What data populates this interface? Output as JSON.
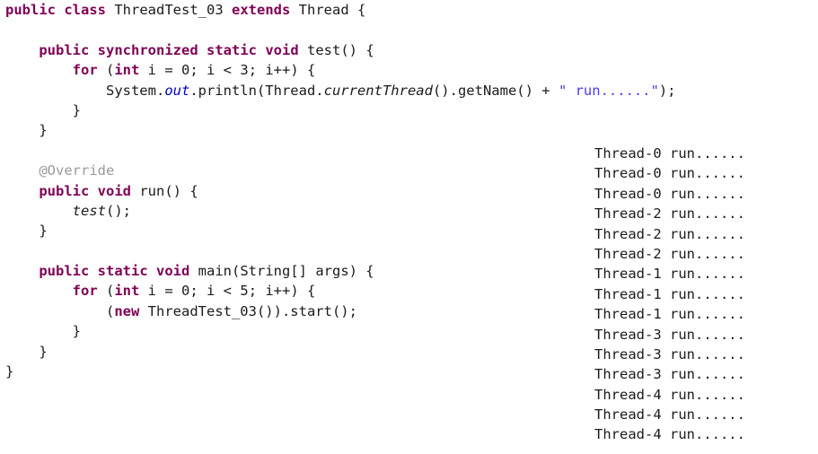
{
  "editor": {
    "name": "java-source-editor",
    "language": "Java",
    "class_name": "ThreadTest_03",
    "colors": {
      "background": "#ffffff",
      "keyword": "#7f0055",
      "identifier": "#1b1b1b",
      "string": "#4a3cf0",
      "static_field": "#0000c8",
      "annotation": "#9a9a9a",
      "console_text": "#1b1b1b"
    },
    "lines": [
      {
        "indent": 0,
        "tokens": [
          {
            "t": "public",
            "c": "kw"
          },
          {
            "t": " ",
            "c": "plain"
          },
          {
            "t": "class",
            "c": "kw"
          },
          {
            "t": " ThreadTest_03 ",
            "c": "ident"
          },
          {
            "t": "extends",
            "c": "kw"
          },
          {
            "t": " Thread {",
            "c": "ident"
          }
        ]
      },
      {
        "indent": 0,
        "tokens": []
      },
      {
        "indent": 1,
        "tokens": [
          {
            "t": "public",
            "c": "kw"
          },
          {
            "t": " ",
            "c": "plain"
          },
          {
            "t": "synchronized",
            "c": "kw"
          },
          {
            "t": " ",
            "c": "plain"
          },
          {
            "t": "static",
            "c": "kw"
          },
          {
            "t": " ",
            "c": "plain"
          },
          {
            "t": "void",
            "c": "kw"
          },
          {
            "t": " test() {",
            "c": "ident"
          }
        ]
      },
      {
        "indent": 2,
        "tokens": [
          {
            "t": "for",
            "c": "kw"
          },
          {
            "t": " (",
            "c": "ident"
          },
          {
            "t": "int",
            "c": "kw"
          },
          {
            "t": " i = ",
            "c": "ident"
          },
          {
            "t": "0",
            "c": "num"
          },
          {
            "t": "; i < ",
            "c": "ident"
          },
          {
            "t": "3",
            "c": "num"
          },
          {
            "t": "; i++) {",
            "c": "ident"
          }
        ]
      },
      {
        "indent": 3,
        "tokens": [
          {
            "t": "System.",
            "c": "ident"
          },
          {
            "t": "out",
            "c": "fieldit"
          },
          {
            "t": ".println(Thread.",
            "c": "ident"
          },
          {
            "t": "currentThread",
            "c": "staticm"
          },
          {
            "t": "().getName() + ",
            "c": "ident"
          },
          {
            "t": "\" run......\"",
            "c": "str"
          },
          {
            "t": ");",
            "c": "ident"
          }
        ]
      },
      {
        "indent": 2,
        "tokens": [
          {
            "t": "}",
            "c": "ident"
          }
        ]
      },
      {
        "indent": 1,
        "tokens": [
          {
            "t": "}",
            "c": "ident"
          }
        ]
      },
      {
        "indent": 0,
        "tokens": []
      },
      {
        "indent": 1,
        "tokens": [
          {
            "t": "@Override",
            "c": "anno"
          }
        ]
      },
      {
        "indent": 1,
        "tokens": [
          {
            "t": "public",
            "c": "kw"
          },
          {
            "t": " ",
            "c": "plain"
          },
          {
            "t": "void",
            "c": "kw"
          },
          {
            "t": " run() {",
            "c": "ident"
          }
        ]
      },
      {
        "indent": 2,
        "tokens": [
          {
            "t": "test",
            "c": "staticm"
          },
          {
            "t": "();",
            "c": "ident"
          }
        ]
      },
      {
        "indent": 1,
        "tokens": [
          {
            "t": "}",
            "c": "ident"
          }
        ]
      },
      {
        "indent": 0,
        "tokens": []
      },
      {
        "indent": 1,
        "tokens": [
          {
            "t": "public",
            "c": "kw"
          },
          {
            "t": " ",
            "c": "plain"
          },
          {
            "t": "static",
            "c": "kw"
          },
          {
            "t": " ",
            "c": "plain"
          },
          {
            "t": "void",
            "c": "kw"
          },
          {
            "t": " main(String[] args) {",
            "c": "ident"
          }
        ]
      },
      {
        "indent": 2,
        "tokens": [
          {
            "t": "for",
            "c": "kw"
          },
          {
            "t": " (",
            "c": "ident"
          },
          {
            "t": "int",
            "c": "kw"
          },
          {
            "t": " i = ",
            "c": "ident"
          },
          {
            "t": "0",
            "c": "num"
          },
          {
            "t": "; i < ",
            "c": "ident"
          },
          {
            "t": "5",
            "c": "num"
          },
          {
            "t": "; i++) {",
            "c": "ident"
          }
        ]
      },
      {
        "indent": 3,
        "tokens": [
          {
            "t": "(",
            "c": "ident"
          },
          {
            "t": "new",
            "c": "kw"
          },
          {
            "t": " ThreadTest_03()).start();",
            "c": "ident"
          }
        ]
      },
      {
        "indent": 2,
        "tokens": [
          {
            "t": "}",
            "c": "ident"
          }
        ]
      },
      {
        "indent": 1,
        "tokens": [
          {
            "t": "}",
            "c": "ident"
          }
        ]
      },
      {
        "indent": 0,
        "tokens": [
          {
            "t": "}",
            "c": "ident"
          }
        ]
      }
    ],
    "plain_source": "public class ThreadTest_03 extends Thread {\n\n    public synchronized static void test() {\n        for (int i = 0; i < 3; i++) {\n            System.out.println(Thread.currentThread().getName() + \" run......\");\n        }\n    }\n\n    @Override\n    public void run() {\n        test();\n    }\n\n    public static void main(String[] args) {\n        for (int i = 0; i < 5; i++) {\n            (new ThreadTest_03()).start();\n        }\n    }\n}"
  },
  "console": {
    "name": "program-output",
    "lines": [
      "Thread-0 run......",
      "Thread-0 run......",
      "Thread-0 run......",
      "Thread-2 run......",
      "Thread-2 run......",
      "Thread-2 run......",
      "Thread-1 run......",
      "Thread-1 run......",
      "Thread-1 run......",
      "Thread-3 run......",
      "Thread-3 run......",
      "Thread-3 run......",
      "Thread-4 run......",
      "Thread-4 run......",
      "Thread-4 run......"
    ]
  }
}
